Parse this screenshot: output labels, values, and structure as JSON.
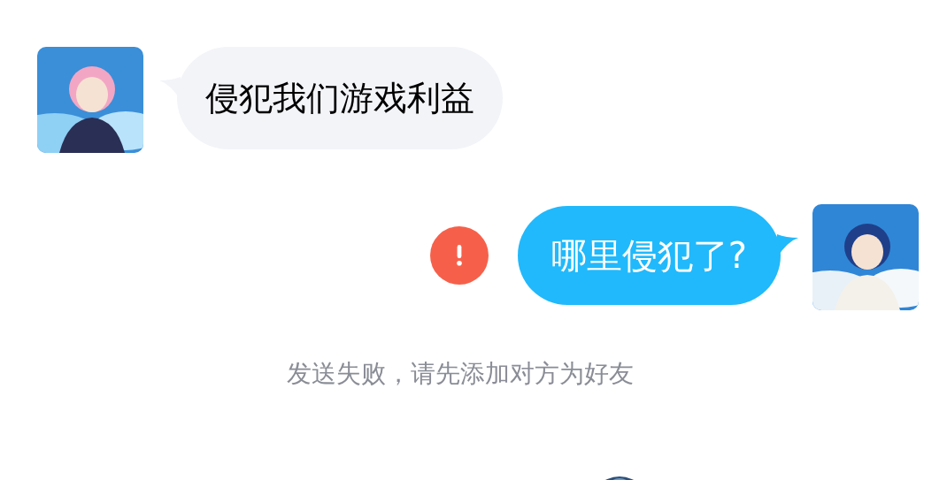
{
  "messages": [
    {
      "kind": "incoming",
      "text": "侵犯我们游戏利益",
      "failed": false
    },
    {
      "kind": "outgoing",
      "text": "哪里侵犯了?",
      "failed": true
    }
  ],
  "notice": "发送失败，请先添加对方为好友"
}
